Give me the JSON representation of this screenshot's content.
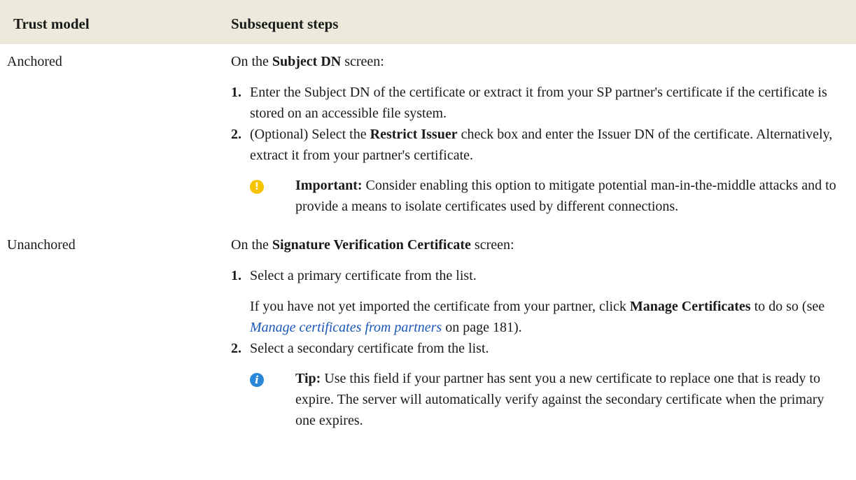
{
  "header": {
    "col1": "Trust model",
    "col2": "Subsequent steps"
  },
  "rows": [
    {
      "label": "Anchored",
      "intro_pre": "On the ",
      "intro_bold": "Subject DN",
      "intro_post": " screen:",
      "steps": [
        {
          "num": "1.",
          "text": "Enter the Subject DN of the certificate or extract it from your SP partner's certificate if the certificate is stored on an accessible file system."
        },
        {
          "num": "2.",
          "text_pre": "(Optional) Select the ",
          "text_bold": "Restrict Issuer",
          "text_post": " check box and enter the Issuer DN of the certificate. Alternatively, extract it from your partner's certificate.",
          "note": {
            "label": "Important:",
            "text": " Consider enabling this option to mitigate potential man-in-the-middle attacks and to provide a means to isolate certificates used by different connections."
          }
        }
      ]
    },
    {
      "label": "Unanchored",
      "intro_pre": "On the ",
      "intro_bold": "Signature Verification Certificate",
      "intro_post": " screen:",
      "steps": [
        {
          "num": "1.",
          "text": "Select a primary certificate from the list.",
          "sub_pre": "If you have not yet imported the certificate from your partner, click ",
          "sub_bold": "Manage Certificates",
          "sub_mid": " to do so (see ",
          "sub_link": "Manage certificates from partners",
          "sub_post": " on page 181)."
        },
        {
          "num": "2.",
          "text": "Select a secondary certificate from the list.",
          "note": {
            "label": "Tip:",
            "text": " Use this field if your partner has sent you a new certificate to replace one that is ready to expire. The server will automatically verify against the secondary certificate when the primary one expires."
          }
        }
      ]
    }
  ],
  "icons": {
    "important": "warning-icon",
    "tip": "info-icon"
  },
  "colors": {
    "header_bg": "#eceadb",
    "link": "#1a56b8",
    "important_icon": "#f6c300",
    "tip_icon": "#2a86d6"
  }
}
